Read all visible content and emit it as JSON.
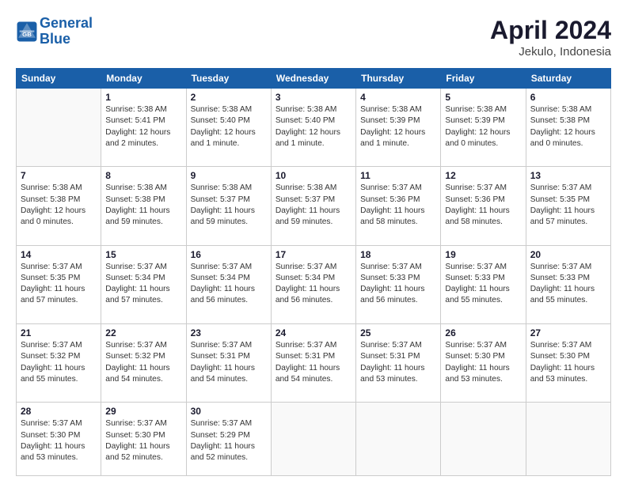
{
  "header": {
    "logo_line1": "General",
    "logo_line2": "Blue",
    "month": "April 2024",
    "location": "Jekulo, Indonesia"
  },
  "weekdays": [
    "Sunday",
    "Monday",
    "Tuesday",
    "Wednesday",
    "Thursday",
    "Friday",
    "Saturday"
  ],
  "weeks": [
    [
      {
        "day": "",
        "info": ""
      },
      {
        "day": "1",
        "info": "Sunrise: 5:38 AM\nSunset: 5:41 PM\nDaylight: 12 hours\nand 2 minutes."
      },
      {
        "day": "2",
        "info": "Sunrise: 5:38 AM\nSunset: 5:40 PM\nDaylight: 12 hours\nand 1 minute."
      },
      {
        "day": "3",
        "info": "Sunrise: 5:38 AM\nSunset: 5:40 PM\nDaylight: 12 hours\nand 1 minute."
      },
      {
        "day": "4",
        "info": "Sunrise: 5:38 AM\nSunset: 5:39 PM\nDaylight: 12 hours\nand 1 minute."
      },
      {
        "day": "5",
        "info": "Sunrise: 5:38 AM\nSunset: 5:39 PM\nDaylight: 12 hours\nand 0 minutes."
      },
      {
        "day": "6",
        "info": "Sunrise: 5:38 AM\nSunset: 5:38 PM\nDaylight: 12 hours\nand 0 minutes."
      }
    ],
    [
      {
        "day": "7",
        "info": "Sunrise: 5:38 AM\nSunset: 5:38 PM\nDaylight: 12 hours\nand 0 minutes."
      },
      {
        "day": "8",
        "info": "Sunrise: 5:38 AM\nSunset: 5:38 PM\nDaylight: 11 hours\nand 59 minutes."
      },
      {
        "day": "9",
        "info": "Sunrise: 5:38 AM\nSunset: 5:37 PM\nDaylight: 11 hours\nand 59 minutes."
      },
      {
        "day": "10",
        "info": "Sunrise: 5:38 AM\nSunset: 5:37 PM\nDaylight: 11 hours\nand 59 minutes."
      },
      {
        "day": "11",
        "info": "Sunrise: 5:37 AM\nSunset: 5:36 PM\nDaylight: 11 hours\nand 58 minutes."
      },
      {
        "day": "12",
        "info": "Sunrise: 5:37 AM\nSunset: 5:36 PM\nDaylight: 11 hours\nand 58 minutes."
      },
      {
        "day": "13",
        "info": "Sunrise: 5:37 AM\nSunset: 5:35 PM\nDaylight: 11 hours\nand 57 minutes."
      }
    ],
    [
      {
        "day": "14",
        "info": "Sunrise: 5:37 AM\nSunset: 5:35 PM\nDaylight: 11 hours\nand 57 minutes."
      },
      {
        "day": "15",
        "info": "Sunrise: 5:37 AM\nSunset: 5:34 PM\nDaylight: 11 hours\nand 57 minutes."
      },
      {
        "day": "16",
        "info": "Sunrise: 5:37 AM\nSunset: 5:34 PM\nDaylight: 11 hours\nand 56 minutes."
      },
      {
        "day": "17",
        "info": "Sunrise: 5:37 AM\nSunset: 5:34 PM\nDaylight: 11 hours\nand 56 minutes."
      },
      {
        "day": "18",
        "info": "Sunrise: 5:37 AM\nSunset: 5:33 PM\nDaylight: 11 hours\nand 56 minutes."
      },
      {
        "day": "19",
        "info": "Sunrise: 5:37 AM\nSunset: 5:33 PM\nDaylight: 11 hours\nand 55 minutes."
      },
      {
        "day": "20",
        "info": "Sunrise: 5:37 AM\nSunset: 5:33 PM\nDaylight: 11 hours\nand 55 minutes."
      }
    ],
    [
      {
        "day": "21",
        "info": "Sunrise: 5:37 AM\nSunset: 5:32 PM\nDaylight: 11 hours\nand 55 minutes."
      },
      {
        "day": "22",
        "info": "Sunrise: 5:37 AM\nSunset: 5:32 PM\nDaylight: 11 hours\nand 54 minutes."
      },
      {
        "day": "23",
        "info": "Sunrise: 5:37 AM\nSunset: 5:31 PM\nDaylight: 11 hours\nand 54 minutes."
      },
      {
        "day": "24",
        "info": "Sunrise: 5:37 AM\nSunset: 5:31 PM\nDaylight: 11 hours\nand 54 minutes."
      },
      {
        "day": "25",
        "info": "Sunrise: 5:37 AM\nSunset: 5:31 PM\nDaylight: 11 hours\nand 53 minutes."
      },
      {
        "day": "26",
        "info": "Sunrise: 5:37 AM\nSunset: 5:30 PM\nDaylight: 11 hours\nand 53 minutes."
      },
      {
        "day": "27",
        "info": "Sunrise: 5:37 AM\nSunset: 5:30 PM\nDaylight: 11 hours\nand 53 minutes."
      }
    ],
    [
      {
        "day": "28",
        "info": "Sunrise: 5:37 AM\nSunset: 5:30 PM\nDaylight: 11 hours\nand 53 minutes."
      },
      {
        "day": "29",
        "info": "Sunrise: 5:37 AM\nSunset: 5:30 PM\nDaylight: 11 hours\nand 52 minutes."
      },
      {
        "day": "30",
        "info": "Sunrise: 5:37 AM\nSunset: 5:29 PM\nDaylight: 11 hours\nand 52 minutes."
      },
      {
        "day": "",
        "info": ""
      },
      {
        "day": "",
        "info": ""
      },
      {
        "day": "",
        "info": ""
      },
      {
        "day": "",
        "info": ""
      }
    ]
  ]
}
